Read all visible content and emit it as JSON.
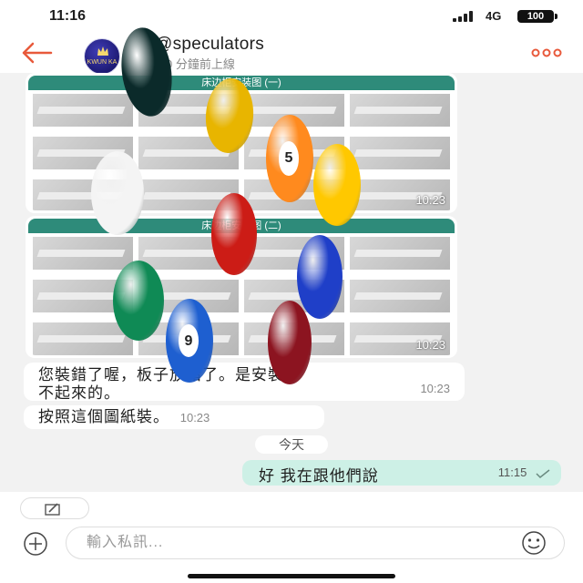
{
  "status": {
    "time": "11:16",
    "network": "4G",
    "battery": "100"
  },
  "header": {
    "contact_name": "@speculators",
    "last_seen": "0 分鐘前上線",
    "avatar_text": "KWUN KA"
  },
  "messages": {
    "image_1": {
      "title": "床边柜安装图 (一)",
      "time": "10:23"
    },
    "image_2": {
      "title": "床边柜安装图 (二)",
      "time": "10:23"
    },
    "text_1": {
      "line_1": "您裝錯了喔，板子放錯了。是安裝",
      "line_2": "不起來的。",
      "time": "10:23"
    },
    "text_2": {
      "text": "按照這個圖紙裝。",
      "time": "10:23"
    },
    "date_divider": "今天",
    "outgoing": {
      "text": "好 我在跟他們說",
      "time": "11:15"
    }
  },
  "composer": {
    "placeholder": "輸入私訊..."
  },
  "overlay_balls": [
    {
      "color": "#0b2a2a",
      "number": ""
    },
    {
      "color": "#e8b500",
      "number": ""
    },
    {
      "color": "#ff8a1e",
      "number": "5"
    },
    {
      "color": "#ffc800",
      "number": ""
    },
    {
      "color": "#f4f4f4",
      "number": ""
    },
    {
      "color": "#cc1c16",
      "number": ""
    },
    {
      "color": "#1f3fc8",
      "number": ""
    },
    {
      "color": "#0f8a55",
      "number": ""
    },
    {
      "color": "#1e5fd0",
      "number": "9"
    },
    {
      "color": "#8c1420",
      "number": ""
    }
  ],
  "colors": {
    "accent": "#e8593b",
    "outgoing_bubble": "#cdf0e6",
    "chat_background": "#f2f2f2"
  }
}
